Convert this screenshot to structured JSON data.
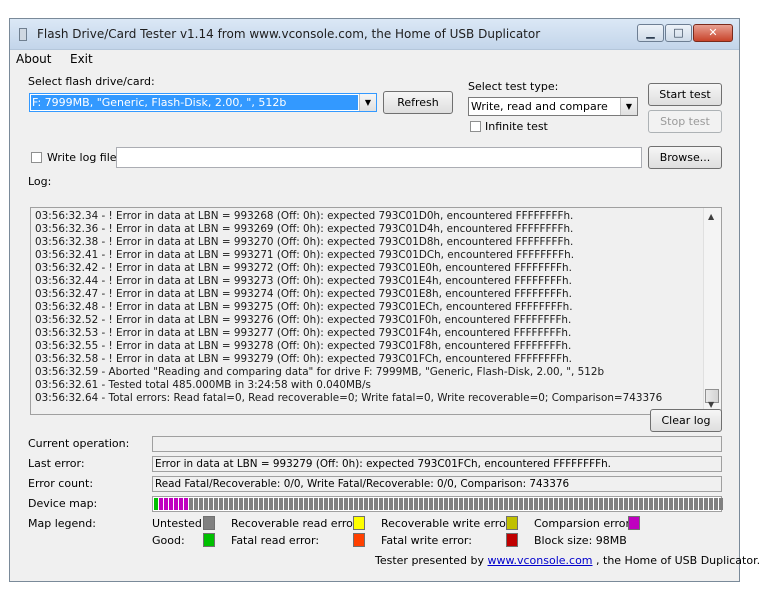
{
  "window": {
    "title": "Flash Drive/Card Tester v1.14 from www.vconsole.com, the Home of USB Duplicator",
    "controls": {
      "minimize": "▁",
      "maximize": "□",
      "close": "✕"
    }
  },
  "menu": [
    "About",
    "Exit"
  ],
  "drive": {
    "label": "Select flash drive/card:",
    "selected": "F: 7999MB, \"Generic, Flash-Disk, 2.00, \", 512b",
    "refresh_label": "Refresh"
  },
  "test_type": {
    "label": "Select test type:",
    "selected": "Write, read and compare",
    "infinite_label": "Infinite test",
    "infinite_checked": false
  },
  "buttons": {
    "start": "Start test",
    "stop": "Stop test",
    "browse": "Browse...",
    "clear": "Clear log"
  },
  "write_log": {
    "label": "Write log file",
    "checked": false,
    "path": ""
  },
  "log": {
    "label": "Log:",
    "lines": [
      "03:56:32.34 - ! Error in data at LBN = 993268 (Off: 0h): expected 793C01D0h, encountered FFFFFFFFh.",
      "03:56:32.36 - ! Error in data at LBN = 993269 (Off: 0h): expected 793C01D4h, encountered FFFFFFFFh.",
      "03:56:32.38 - ! Error in data at LBN = 993270 (Off: 0h): expected 793C01D8h, encountered FFFFFFFFh.",
      "03:56:32.41 - ! Error in data at LBN = 993271 (Off: 0h): expected 793C01DCh, encountered FFFFFFFFh.",
      "03:56:32.42 - ! Error in data at LBN = 993272 (Off: 0h): expected 793C01E0h, encountered FFFFFFFFh.",
      "03:56:32.44 - ! Error in data at LBN = 993273 (Off: 0h): expected 793C01E4h, encountered FFFFFFFFh.",
      "03:56:32.47 - ! Error in data at LBN = 993274 (Off: 0h): expected 793C01E8h, encountered FFFFFFFFh.",
      "03:56:32.48 - ! Error in data at LBN = 993275 (Off: 0h): expected 793C01ECh, encountered FFFFFFFFh.",
      "03:56:32.52 - ! Error in data at LBN = 993276 (Off: 0h): expected 793C01F0h, encountered FFFFFFFFh.",
      "03:56:32.53 - ! Error in data at LBN = 993277 (Off: 0h): expected 793C01F4h, encountered FFFFFFFFh.",
      "03:56:32.55 - ! Error in data at LBN = 993278 (Off: 0h): expected 793C01F8h, encountered FFFFFFFFh.",
      "03:56:32.58 - ! Error in data at LBN = 993279 (Off: 0h): expected 793C01FCh, encountered FFFFFFFFh.",
      "03:56:32.59 - Aborted \"Reading and comparing data\" for drive F: 7999MB, \"Generic, Flash-Disk, 2.00, \", 512b",
      "03:56:32.61 - Tested total 485.000MB in 3:24:58 with  0.040MB/s",
      "03:56:32.64 - Total errors: Read fatal=0, Read recoverable=0; Write fatal=0, Write recoverable=0; Comparison=743376"
    ]
  },
  "status": {
    "current_operation_label": "Current operation:",
    "current_operation": "",
    "last_error_label": "Last error:",
    "last_error": "Error in data at LBN = 993279 (Off: 0h): expected 793C01FCh, encountered FFFFFFFFh.",
    "error_count_label": "Error count:",
    "error_count": "Read Fatal/Recoverable: 0/0, Write Fatal/Recoverable: 0/0, Comparison: 743376",
    "device_map_label": "Device map:",
    "device_map": {
      "good_blocks": 1,
      "comparison_error_blocks": 6,
      "untested_blocks": 107
    }
  },
  "legend": {
    "label": "Map legend:",
    "untested": "Untested:",
    "good": "Good:",
    "recoverable_read": "Recoverable read error:",
    "fatal_read": "Fatal read error:",
    "recoverable_write": "Recoverable write error:",
    "fatal_write": "Fatal write error:",
    "comparison": "Comparsion error:",
    "block_size": "Block size: 98MB",
    "colors": {
      "untested": "#808080",
      "good": "#00c000",
      "recoverable_read": "#ffff00",
      "fatal_read": "#ff4000",
      "recoverable_write": "#c0c000",
      "fatal_write": "#c00000",
      "comparison": "#c000c0"
    }
  },
  "footer": {
    "prefix": "Tester presented by ",
    "link": "www.vconsole.com",
    "suffix": " , the Home of USB Duplicator."
  }
}
